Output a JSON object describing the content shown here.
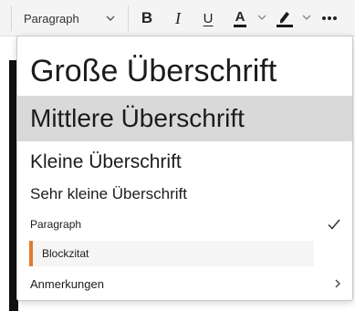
{
  "toolbar": {
    "block_format_value": "Paragraph",
    "bold_label": "B",
    "italic_label": "I",
    "underline_label": "U",
    "font_color_label": "A",
    "more_icon": "more-horizontal-icon"
  },
  "format_menu": {
    "items": [
      {
        "label": "Große Überschrift",
        "style": "heading-1"
      },
      {
        "label": "Mittlere Überschrift",
        "style": "heading-2",
        "highlighted": true
      },
      {
        "label": "Kleine Überschrift",
        "style": "heading-3"
      },
      {
        "label": "Sehr kleine Überschrift",
        "style": "heading-4"
      },
      {
        "label": "Paragraph",
        "style": "paragraph",
        "selected": true
      },
      {
        "label": "Blockzitat",
        "style": "blockquote"
      },
      {
        "label": "Anmerkungen",
        "style": "submenu"
      }
    ]
  },
  "colors": {
    "highlight_bg": "#d9d9d9",
    "blockquote_accent": "#e07b2e",
    "toolbar_bg": "#f4f4f4"
  }
}
